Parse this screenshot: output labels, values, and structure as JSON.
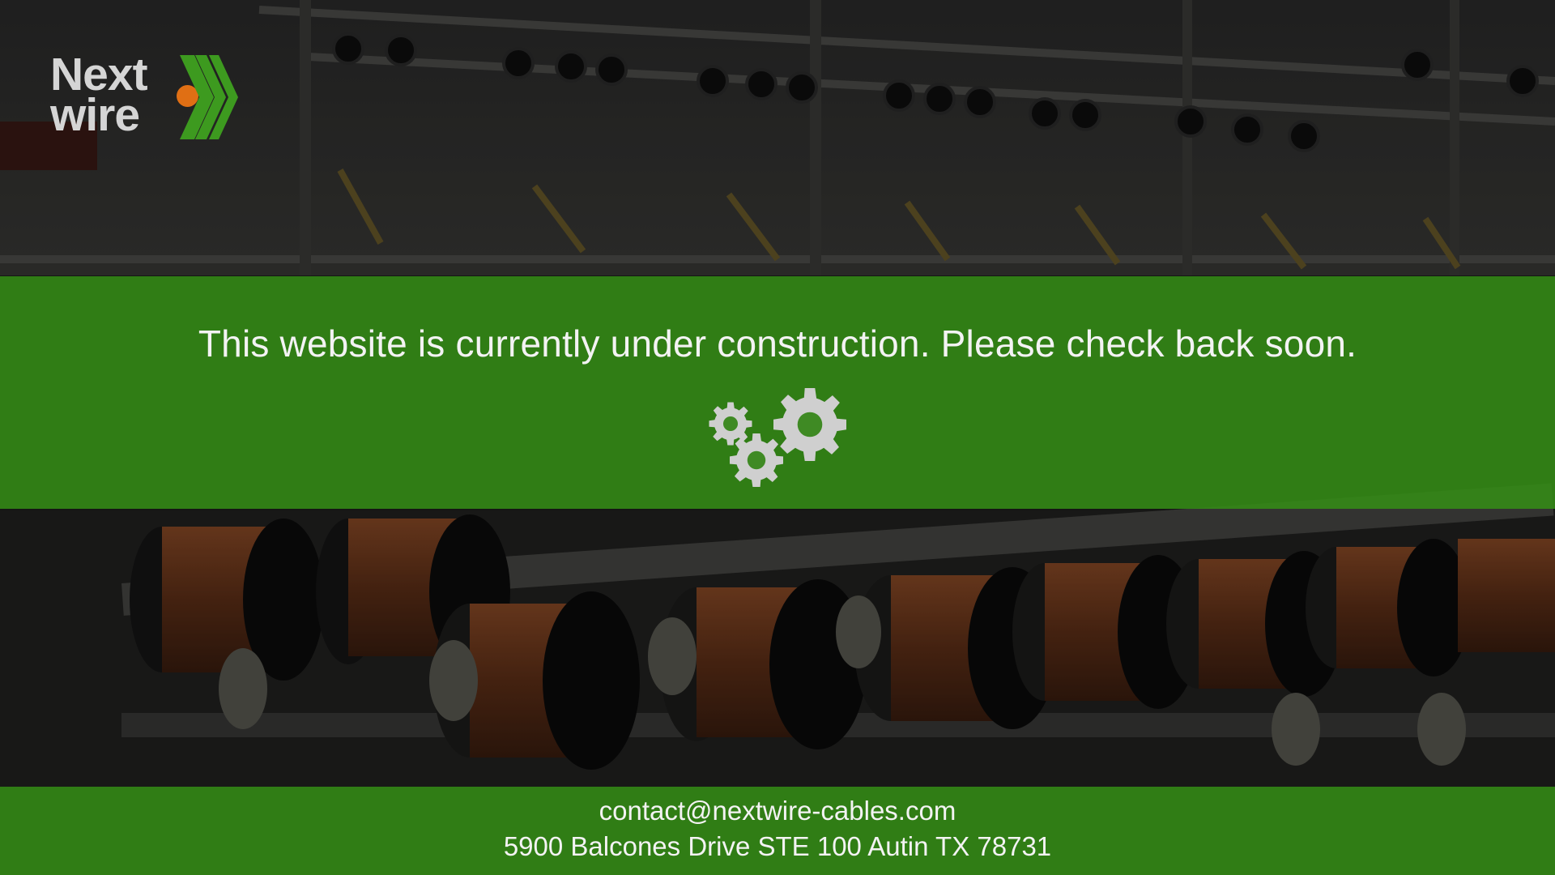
{
  "brand": {
    "line1": "Next",
    "line2": "wire",
    "colors": {
      "text": "#d5d5d5",
      "dot": "#e06f14",
      "chevrons": "#3d9a1f"
    }
  },
  "banner": {
    "message": "This website is currently under construction. Please check back soon.",
    "icon": "gears-icon"
  },
  "footer": {
    "email": "contact@nextwire-cables.com",
    "address": "5900 Balcones Drive STE 100 Autin TX 78731"
  },
  "colors": {
    "band": "#348c16",
    "text": "#f3f3f3",
    "background": "#1b1b1a",
    "gear": "#cfcfcf"
  }
}
